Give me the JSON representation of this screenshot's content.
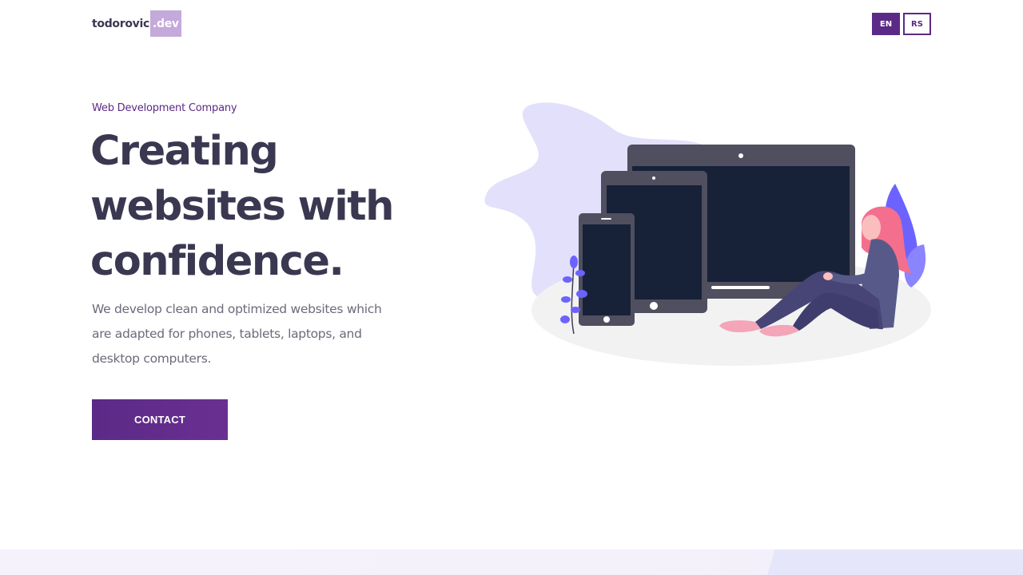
{
  "header": {
    "logo_name": "todorovic",
    "logo_tld": ".dev",
    "languages": [
      {
        "label": "EN",
        "active": true
      },
      {
        "label": "RS",
        "active": false
      }
    ]
  },
  "hero": {
    "eyebrow": "Web Development Company",
    "headline_lines": [
      "Creating",
      "websites with",
      "confidence."
    ],
    "description": "We develop clean and optimized websites which are adapted for phones, tablets, laptops, and desktop computers.",
    "cta_label": "CONTACT"
  },
  "colors": {
    "brand": "#5b2a86",
    "heading": "#3a3851",
    "body_text": "#6b6b7b",
    "logo_tld_bg": "#c4a9db",
    "illustration_blob": "#e2e0fb",
    "device_frame": "#4f4f5f",
    "device_screen": "#172239",
    "accent_pink": "#f46f8d",
    "accent_blue": "#6c63ff"
  },
  "icons": {
    "illustration": "devices-illustration"
  }
}
